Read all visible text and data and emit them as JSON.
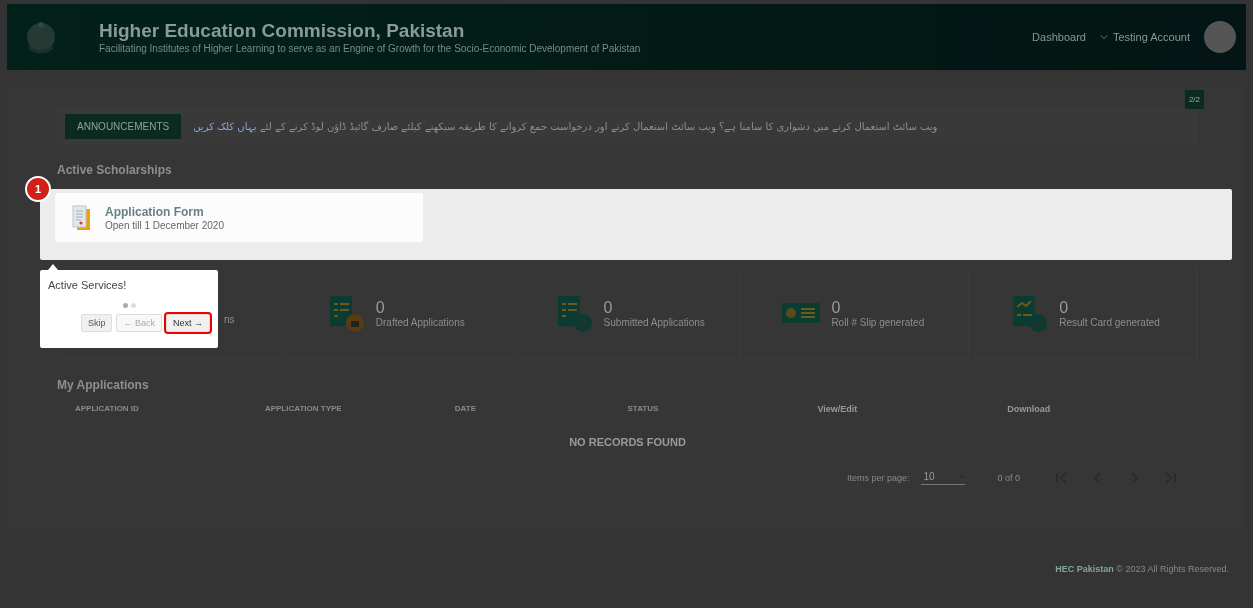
{
  "header": {
    "title": "Higher Education Commission, Pakistan",
    "subtitle": "Facilitating Institutes of Higher Learning to serve as an Engine of Growth for the Socio-Economic Development of Pakistan",
    "nav": [
      "Dashboard",
      "Testing Account"
    ]
  },
  "page_counter": "2/2",
  "announcements": {
    "label": "ANNOUNCEMENTS",
    "text": "ویب سائٹ استعمال کرنے میں دشواری کا سامنا ہے؟ ویب سائٹ استعمال کرنے اور درخواست جمع کروانے کا طریقہ سیکھنے کیلئے صارف گائیڈ ڈاؤن لوڈ کرنے کے لئے",
    "link": "یہاں کلک کریں"
  },
  "active_scholarships": {
    "title": "Active Scholarships",
    "items": [
      {
        "title": "Application Form",
        "subtitle": "Open till 1 December 2020"
      }
    ]
  },
  "tour": {
    "step_badge": "1",
    "title": "Active Services!",
    "steps": [
      {
        "selected": true
      },
      {
        "selected": false
      }
    ],
    "buttons": [
      {
        "label": "Skip",
        "disabled": false,
        "focused": false
      },
      {
        "label": "← Back",
        "disabled": true,
        "focused": false
      },
      {
        "label": "Next →",
        "disabled": false,
        "focused": true
      }
    ]
  },
  "stats": [
    {
      "kind": "hidden",
      "label": "ns"
    },
    {
      "kind": "draft",
      "count": "0",
      "label": "Drafted Applications"
    },
    {
      "kind": "submitted",
      "count": "0",
      "label": "Submitted Applications"
    },
    {
      "kind": "slip",
      "count": "0",
      "label": "Roll # Slip generated"
    },
    {
      "kind": "result",
      "count": "0",
      "label": "Result Card generated"
    }
  ],
  "my_applications": {
    "title": "My Applications",
    "columns": [
      "APPLICATION ID",
      "APPLICATION TYPE",
      "DATE",
      "STATUS",
      "View/Edit",
      "Download"
    ],
    "empty_message": "NO RECORDS FOUND",
    "paginator": {
      "items_label": "Items per page:",
      "page_size": "10",
      "range": "0 of 0"
    }
  },
  "footer": {
    "brand": "HEC Pakistan",
    "text": "© 2023 All Rights Reserved."
  }
}
